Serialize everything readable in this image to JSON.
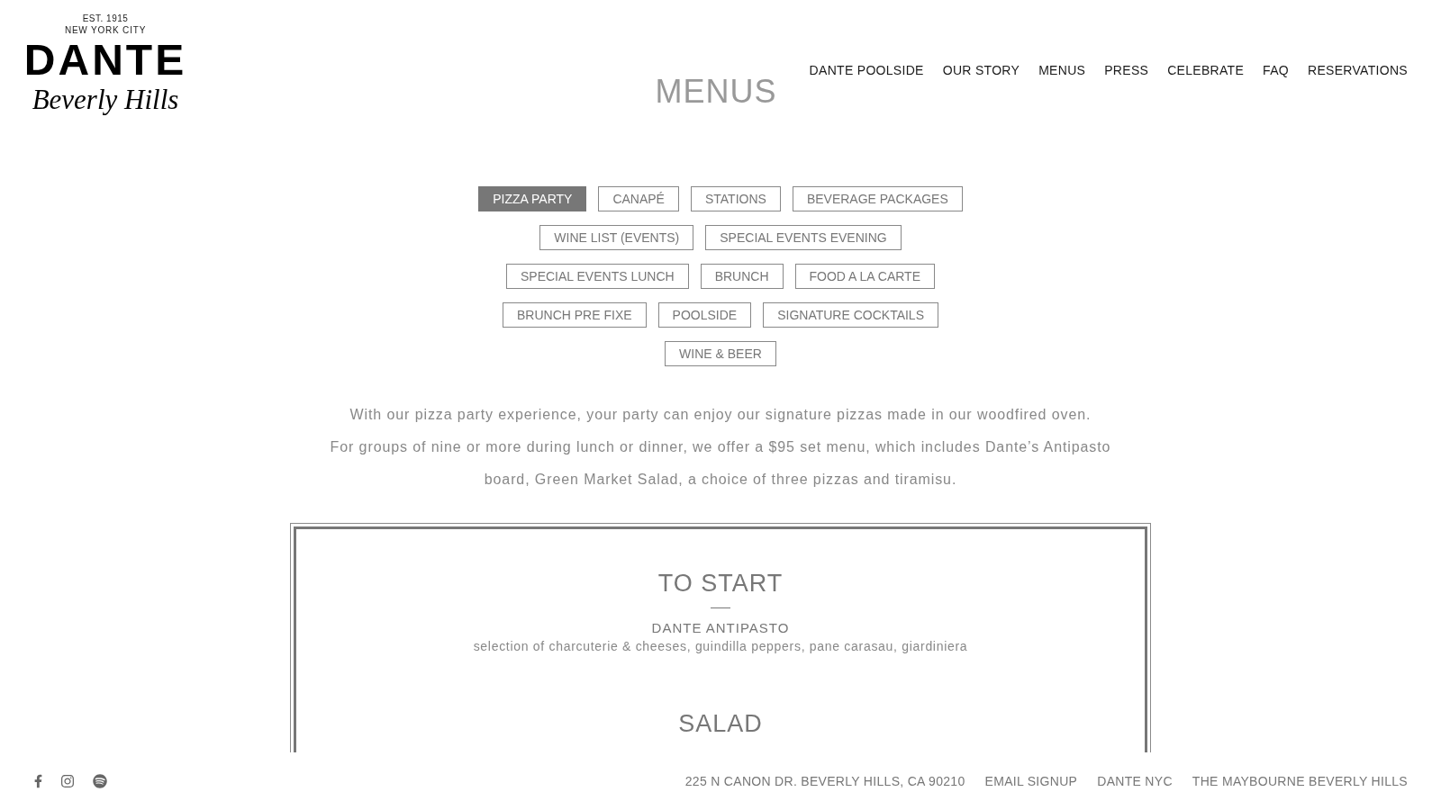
{
  "logo": {
    "established": "EST. 1915",
    "city": "NEW YORK CITY",
    "name": "DANTE",
    "location": "Beverly Hills"
  },
  "page_title": "MENUS",
  "nav": [
    "DANTE POOLSIDE",
    "OUR STORY",
    "MENUS",
    "PRESS",
    "CELEBRATE",
    "FAQ",
    "RESERVATIONS"
  ],
  "menu_tabs": [
    {
      "label": "PIZZA PARTY",
      "selected": true
    },
    {
      "label": "CANAPÉ",
      "selected": false
    },
    {
      "label": "STATIONS",
      "selected": false
    },
    {
      "label": "BEVERAGE PACKAGES",
      "selected": false
    },
    {
      "label": "WINE LIST (EVENTS)",
      "selected": false
    },
    {
      "label": "SPECIAL EVENTS EVENING",
      "selected": false
    },
    {
      "label": "SPECIAL EVENTS LUNCH",
      "selected": false
    },
    {
      "label": "BRUNCH",
      "selected": false
    },
    {
      "label": "FOOD A LA CARTE",
      "selected": false
    },
    {
      "label": "BRUNCH PRE FIXE",
      "selected": false
    },
    {
      "label": "POOLSIDE",
      "selected": false
    },
    {
      "label": "SIGNATURE COCKTAILS",
      "selected": false
    },
    {
      "label": "WINE & BEER",
      "selected": false
    }
  ],
  "intro": [
    "With our pizza party experience, your party can enjoy our signature pizzas made in our woodfired oven.",
    "For groups of nine or more during lunch or dinner, we offer a $95 set menu, which includes Dante’s Antipasto board, Green Market Salad, a choice of three pizzas and tiramisu."
  ],
  "menu_card": {
    "sections": [
      {
        "title": "TO START",
        "items": [
          {
            "name": "DANTE ANTIPASTO",
            "description": "selection of charcuterie & cheeses, guindilla peppers, pane carasau, giardiniera"
          }
        ]
      },
      {
        "title": "SALAD"
      }
    ]
  },
  "footer": {
    "links": [
      "225 N CANON DR. BEVERLY HILLS, CA 90210",
      "EMAIL SIGNUP",
      "DANTE NYC",
      "THE MAYBOURNE BEVERLY HILLS"
    ]
  }
}
